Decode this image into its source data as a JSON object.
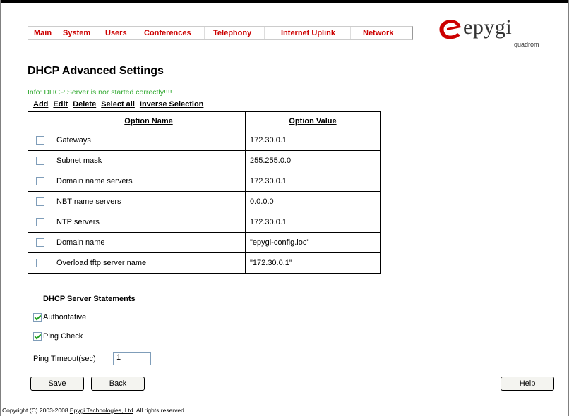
{
  "menu": [
    "Main",
    "System",
    "Users",
    "Conferences",
    "Telephony",
    "Internet Uplink",
    "Network"
  ],
  "logo": {
    "word": "epygi",
    "sub": "quadrom"
  },
  "page_title": "DHCP Advanced Settings",
  "info": "Info: DHCP Server is nor started correctly!!!!",
  "actions": [
    "Add",
    "Edit",
    "Delete",
    "Select all",
    "Inverse Selection"
  ],
  "table": {
    "headers": [
      "Option Name",
      "Option Value"
    ],
    "rows": [
      {
        "name": "Gateways",
        "value": "172.30.0.1"
      },
      {
        "name": "Subnet mask",
        "value": "255.255.0.0"
      },
      {
        "name": "Domain name servers",
        "value": "172.30.0.1"
      },
      {
        "name": "NBT name servers",
        "value": "0.0.0.0"
      },
      {
        "name": "NTP servers",
        "value": "172.30.0.1"
      },
      {
        "name": "Domain name",
        "value": "\"epygi-config.loc\""
      },
      {
        "name": "Overload tftp server name",
        "value": "\"172.30.0.1\""
      }
    ]
  },
  "statements": {
    "title": "DHCP Server Statements",
    "authoritative": {
      "label": "Authoritative",
      "checked": true
    },
    "ping_check": {
      "label": "Ping Check",
      "checked": true
    },
    "ping_timeout_label": "Ping Timeout(sec)",
    "ping_timeout_value": "1"
  },
  "buttons": {
    "save": "Save",
    "back": "Back",
    "help": "Help"
  },
  "footer": {
    "prefix": "Copyright (C) 2003-2008 ",
    "link": "Epygi Technologies, Ltd",
    "suffix": ". All rights reserved."
  },
  "colors": {
    "menu": "#cc0000",
    "info": "#33aa33",
    "logo_red": "#cc0000"
  }
}
